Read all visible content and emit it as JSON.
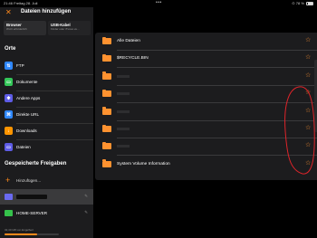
{
  "status": {
    "time": "21:46  Freitag 28. Juli",
    "dots": "•••",
    "right": "⊙ 78 %"
  },
  "header": {
    "title": "Dateien hinzufügen",
    "close_icon": "close-icon"
  },
  "tabs": [
    {
      "title": "Browser",
      "subtitle": "Wi-Fi erforderlich"
    },
    {
      "title": "USB-Kabel",
      "subtitle": "Finder oder iTunes ve..."
    }
  ],
  "sections": {
    "orte": "Orte",
    "freigaben": "Gespeicherte Freigaben"
  },
  "locations": [
    {
      "label": "FTP",
      "icon": "ftp-icon",
      "color": "#2f88ff",
      "glyph": "⇅"
    },
    {
      "label": "Dokumente",
      "icon": "documents-icon",
      "color": "#34c759",
      "glyph": "▭"
    },
    {
      "label": "Andere Apps",
      "icon": "other-apps-icon",
      "color": "#5e5ce6",
      "glyph": "✱"
    },
    {
      "label": "Direkte URL",
      "icon": "link-icon",
      "color": "#2f88ff",
      "glyph": "⌘"
    },
    {
      "label": "Downloads",
      "icon": "download-icon",
      "color": "#ff9500",
      "glyph": "↓"
    },
    {
      "label": "Dateien",
      "icon": "files-icon",
      "color": "#5e5ce6",
      "glyph": "▭"
    }
  ],
  "shares": {
    "add_label": "Hinzufügen...",
    "server_label": "HOME-SERVER"
  },
  "storage": {
    "text": "32,40 GB von Engelbert",
    "fraction": 0.6
  },
  "files": [
    {
      "name": "Alle Dateien"
    },
    {
      "name": "$RECYCLE.BIN"
    },
    {
      "name": ""
    },
    {
      "name": ""
    },
    {
      "name": ""
    },
    {
      "name": ""
    },
    {
      "name": ""
    },
    {
      "name": "System Volume Information"
    }
  ],
  "colors": {
    "accent": "#ff9230",
    "annotation": "#e0242a"
  }
}
